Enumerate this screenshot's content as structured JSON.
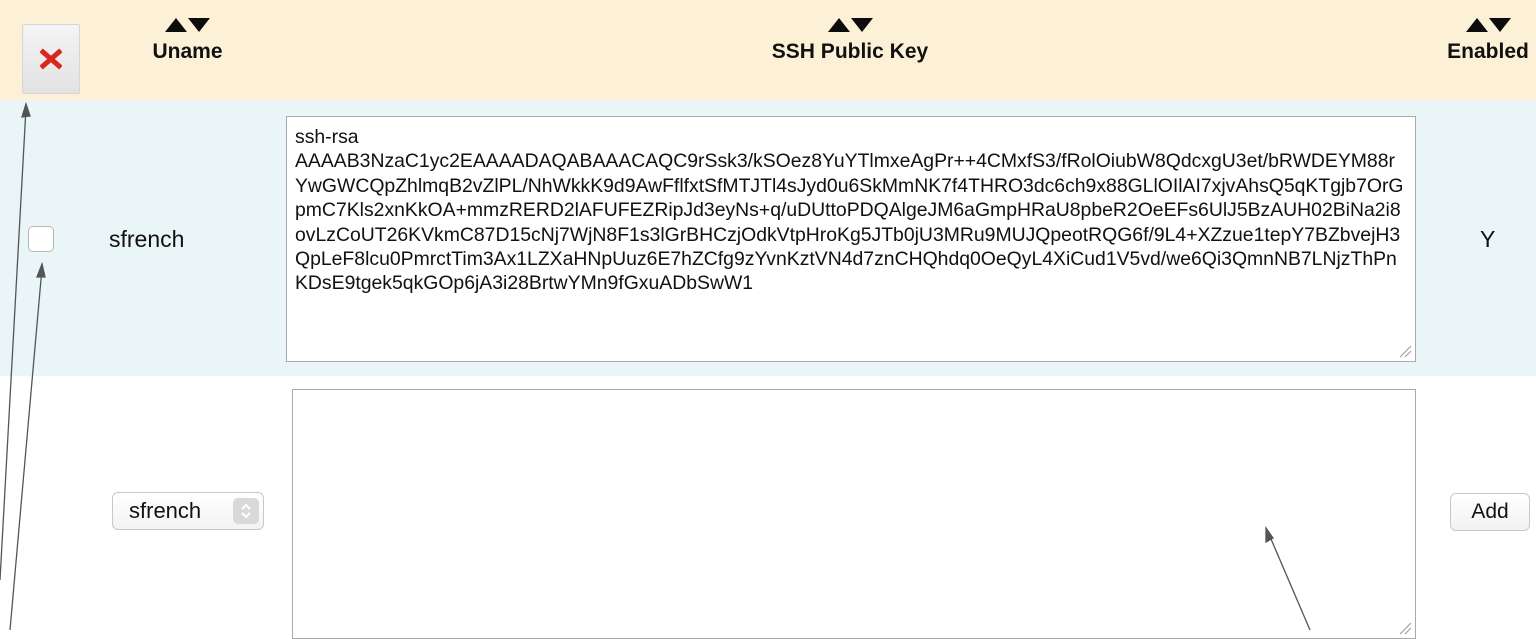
{
  "header": {
    "delete_icon": "x-icon",
    "columns": {
      "uname": "Uname",
      "ssh_key": "SSH Public Key",
      "enabled": "Enabled"
    }
  },
  "rows": [
    {
      "checked": false,
      "uname": "sfrench",
      "ssh_key": "ssh-rsa\nAAAAB3NzaC1yc2EAAAADAQABAAACAQC9rSsk3/kSOez8YuYTlmxeAgPr++4CMxfS3/fRolOiubW8QdcxgU3et/bRWDEYM88rYwGWCQpZhlmqB2vZlPL/NhWkkK9d9AwFflfxtSfMTJTl4sJyd0u6SkMmNK7f4THRO3dc6ch9x88GLlOIlAI7xjvAhsQ5qKTgjb7OrGpmC7Kls2xnKkOA+mmzRERD2lAFUFEZRipJd3eyNs+q/uDUttoPDQAlgeJM6aGmpHRaU8pbeR2OeEFs6UlJ5BzAUH02BiNa2i8ovLzCoUT26KVkmC87D15cNj7WjN8F1s3lGrBHCzjOdkVtpHroKg5JTb0jU3MRu9MUJQpeotRQG6f/9L4+XZzue1tepY7BZbvejH3QpLeF8lcu0PmrctTim3Ax1LZXaHNpUuz6E7hZCfg9zYvnKztVN4d7znCHQhdq0OeQyL4XiCud1V5vd/we6Qi3QmnNB7LNjzThPnKDsE9tgek5qkGOp6jA3i28BrtwYMn9fGxuADbSwW1",
      "enabled": "Y"
    }
  ],
  "add_form": {
    "user_select_value": "sfrench",
    "key_value": "",
    "add_label": "Add"
  },
  "colors": {
    "header_bg": "#fcf1d6",
    "row_bg": "#e9f5f7",
    "delete_red": "#d9271d"
  }
}
